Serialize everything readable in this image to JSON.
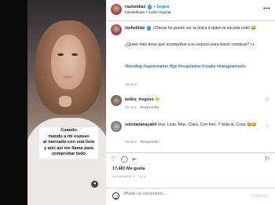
{
  "post": {
    "username": "rasheldiaz",
    "verified_icon": "verified-badge-icon",
    "follow_label": "Seguir",
    "separator": "•",
    "audio_credit": "latewithkate • Audio original",
    "more_icon": "more-options-icon",
    "caption_text": "¡Chicas no puedo ser la única a quien le suceda esto! 😂",
    "caption_question": "¿Quién más tiene que acompañar a su esposo para hacer compras? 👀",
    "hashtags": "#trending #supermarket #fyp #mujerlatina #couple #instagramreels",
    "time": "35 sem"
  },
  "video_caption": {
    "lines": [
      "Cuando",
      "mando a mi esposo",
      "al mercado con una lista",
      "y aún así me llama para",
      "comprobar todo"
    ]
  },
  "comments": [
    {
      "username": "belkis_fregoso",
      "text": "👏",
      "time": "35 sem",
      "reply_label": "Responder"
    },
    {
      "username": "soledadanaya64",
      "text": "Una. Lista. Más. Clara. Con foto. Y toda la. Cosa 😂😂",
      "time": "32 sem",
      "reply_label": "Responder"
    }
  ],
  "stats": {
    "likes": "17,481 Me gusta",
    "date": "NOVIEMBRE 17, 2021"
  },
  "comment_box": {
    "placeholder": "Añade un comentario...",
    "publish_label": "Publicar"
  },
  "colors": {
    "accent_blue": "#0095f6",
    "verified_blue": "#3897f0",
    "hashtag_blue": "#00376b",
    "publish_disabled": "#b2dffc",
    "muted_gray": "#8e8e8e"
  }
}
